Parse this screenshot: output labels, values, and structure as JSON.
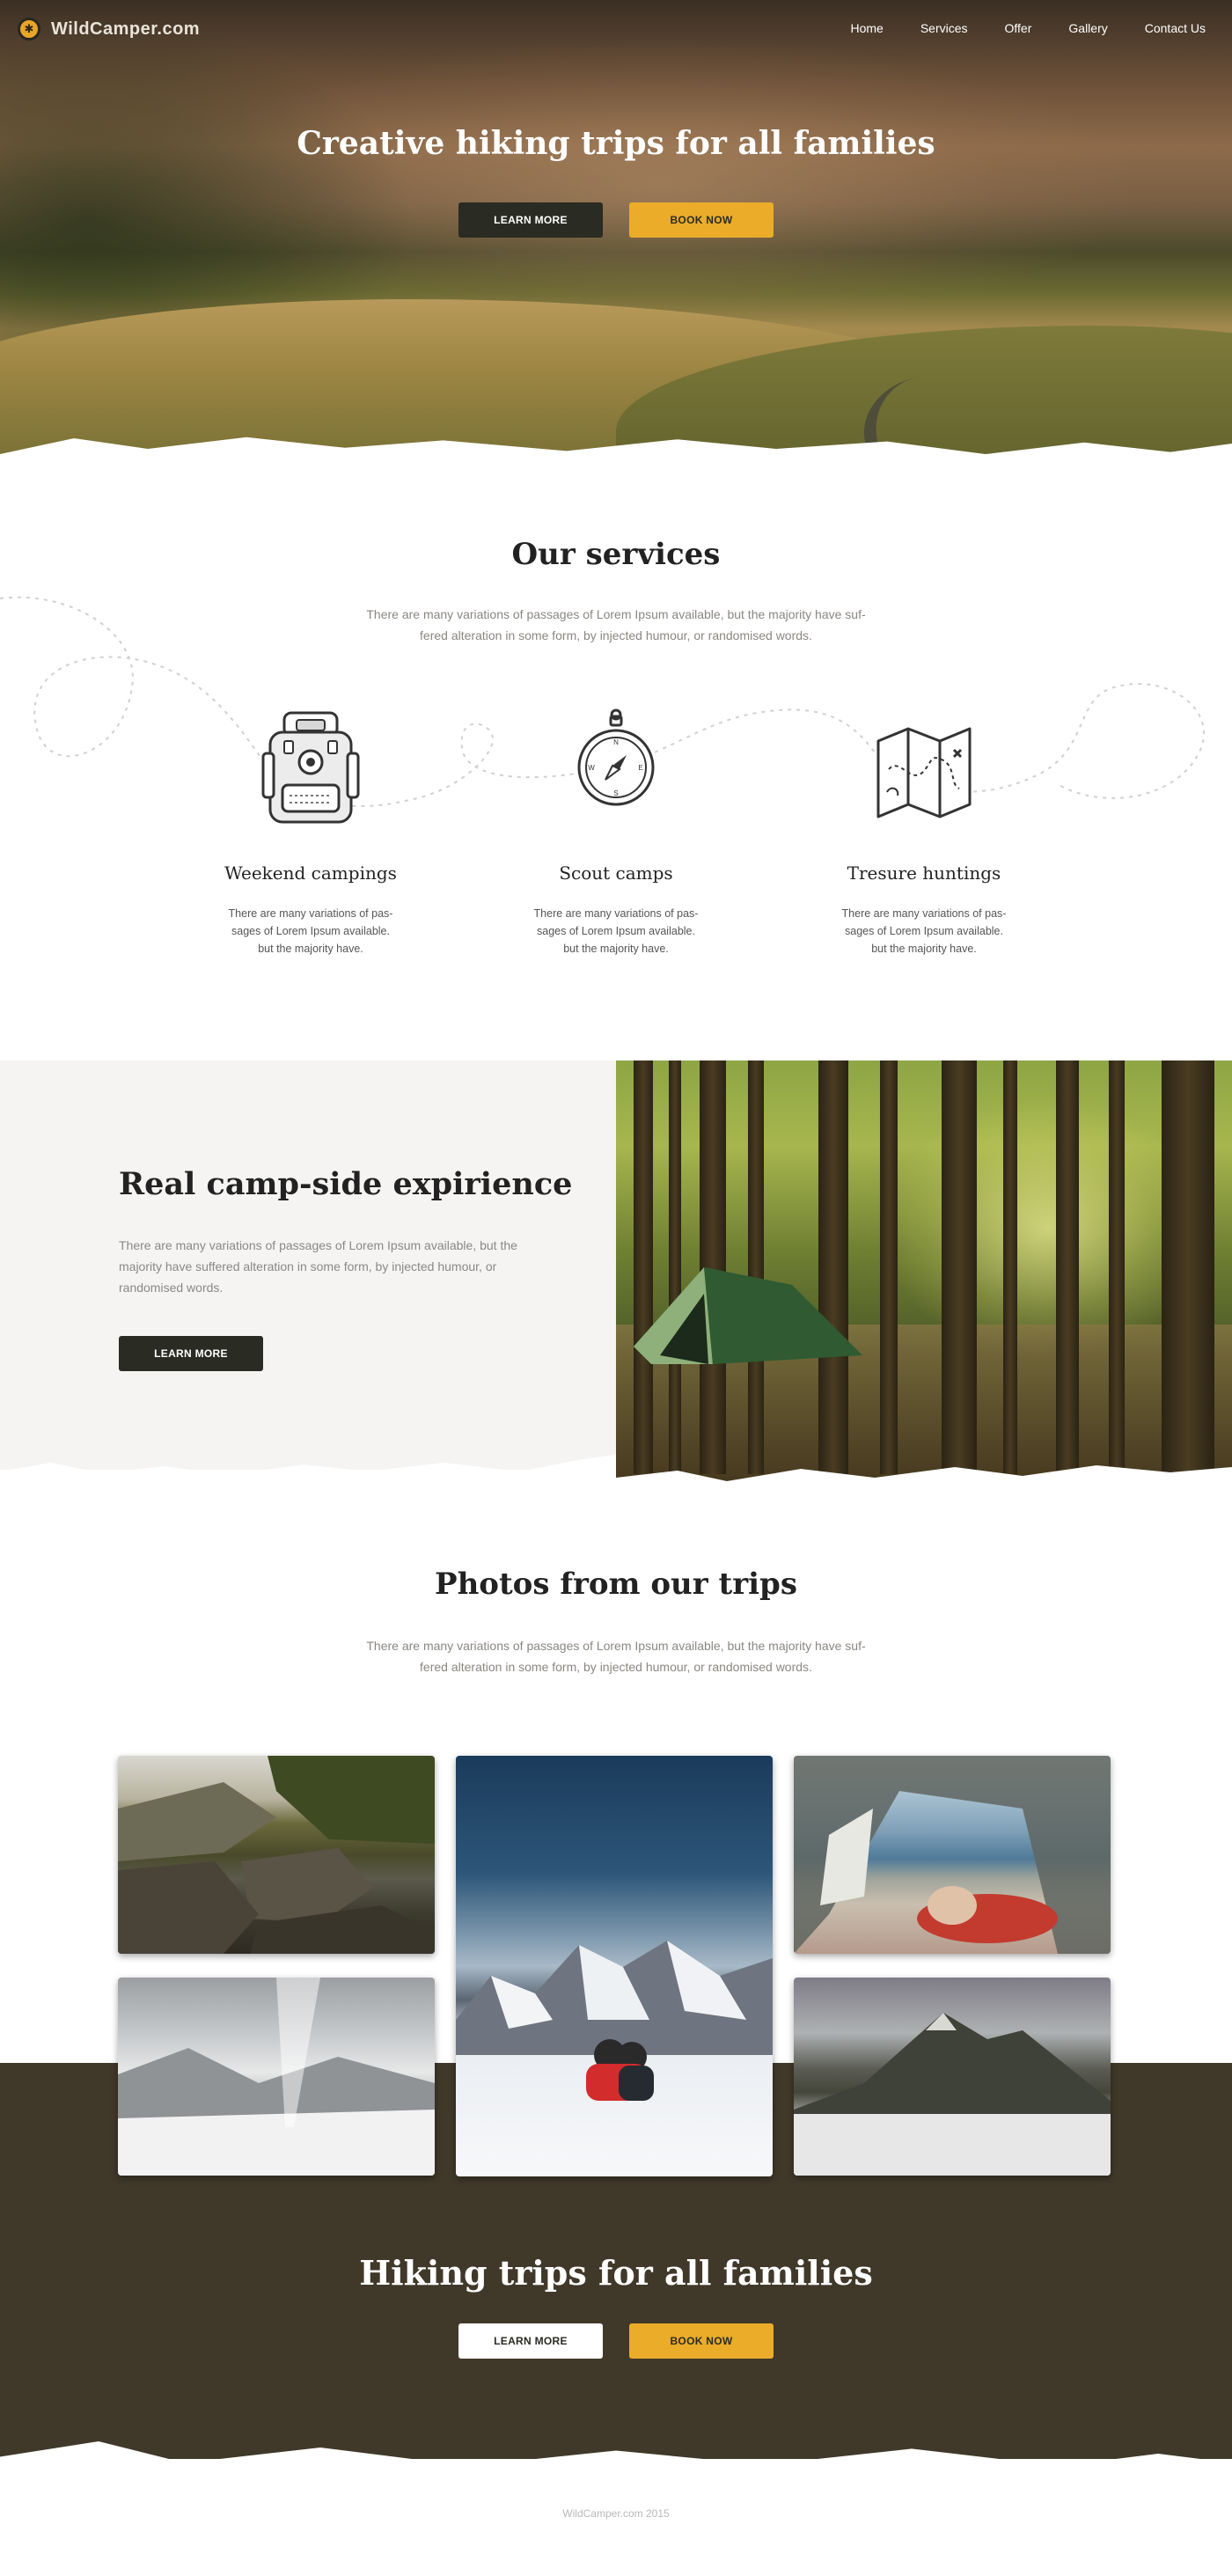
{
  "brand": {
    "logo_text": "WildCamper.com"
  },
  "nav": {
    "items": [
      {
        "label": "Home"
      },
      {
        "label": "Services"
      },
      {
        "label": "Offer"
      },
      {
        "label": "Gallery"
      },
      {
        "label": "Contact Us"
      }
    ]
  },
  "hero": {
    "title": "Creative hiking trips for all families",
    "learn_more": "LEARN MORE",
    "book_now": "BOOK NOW"
  },
  "services": {
    "title": "Our services",
    "description": "There are many variations of passages of Lorem Ipsum available, but the majority have suf- fered alteration in some form, by injected humour, or randomised words.",
    "items": [
      {
        "title": "Weekend campings",
        "icon": "backpack-icon",
        "description": "There are many variations of pas- sages of Lorem Ipsum available. but the majority have."
      },
      {
        "title": "Scout camps",
        "icon": "compass-icon",
        "description": "There are many variations of pas- sages of Lorem Ipsum available. but the majority have."
      },
      {
        "title": "Tresure huntings",
        "icon": "map-icon",
        "description": "There are many variations of pas- sages of Lorem Ipsum available. but the majority have."
      }
    ]
  },
  "camp": {
    "title": "Real camp-side expirience",
    "description": "There are many variations of passages of Lorem Ipsum available, but the majority have suffered alteration in some form, by injected humour, or randomised words.",
    "button": "LEARN MORE"
  },
  "photos": {
    "title": "Photos from our trips",
    "description": "There are many variations of passages of Lorem Ipsum available, but the majority have suf- fered alteration in some form, by injected humour, or randomised words."
  },
  "bottom": {
    "title": "Hiking trips for all families",
    "learn_more": "LEARN MORE",
    "book_now": "BOOK NOW"
  },
  "footer": {
    "text": "WildCamper.com 2015"
  },
  "colors": {
    "accent": "#ebac2a",
    "dark": "#2a2b22",
    "band": "#403829"
  }
}
